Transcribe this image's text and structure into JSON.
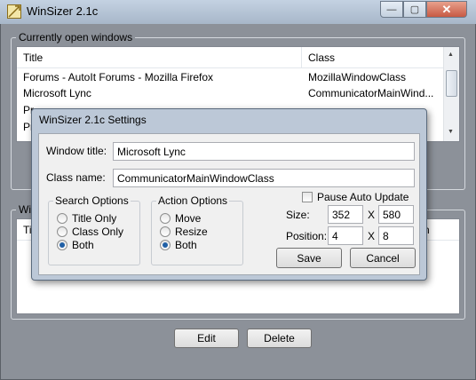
{
  "window": {
    "title": "WinSizer 2.1c",
    "controls": {
      "min": "—",
      "max": "▢",
      "close": "✕"
    }
  },
  "open_windows": {
    "group_label": "Currently open windows",
    "columns": [
      "Title",
      "Class"
    ],
    "rows": [
      {
        "title": "Forums - AutoIt Forums - Mozilla Firefox",
        "class": "MozillaWindowClass"
      },
      {
        "title": "Microsoft Lync",
        "class": "CommunicatorMainWind..."
      },
      {
        "title": "Pr",
        "class": ""
      },
      {
        "title": "Pr",
        "class": ""
      }
    ]
  },
  "saved_windows": {
    "group_label": "Wi",
    "column_partial_left": "Ti",
    "column_partial_right": "n"
  },
  "buttons": {
    "edit": "Edit",
    "delete": "Delete"
  },
  "dialog": {
    "title": "WinSizer 2.1c Settings",
    "window_title_label": "Window title:",
    "window_title_value": "Microsoft Lync",
    "class_name_label": "Class name:",
    "class_name_value": "CommunicatorMainWindowClass",
    "search_options": {
      "legend": "Search Options",
      "options": [
        "Title Only",
        "Class Only",
        "Both"
      ],
      "selected": "Both"
    },
    "action_options": {
      "legend": "Action Options",
      "options": [
        "Move",
        "Resize",
        "Both"
      ],
      "selected": "Both"
    },
    "pause_auto_update": {
      "label": "Pause Auto Update",
      "checked": false
    },
    "size": {
      "label": "Size:",
      "width": "352",
      "height": "580",
      "sep": "X"
    },
    "position": {
      "label": "Position:",
      "x": "4",
      "y": "8",
      "sep": "X"
    },
    "save_label": "Save",
    "cancel_label": "Cancel"
  }
}
